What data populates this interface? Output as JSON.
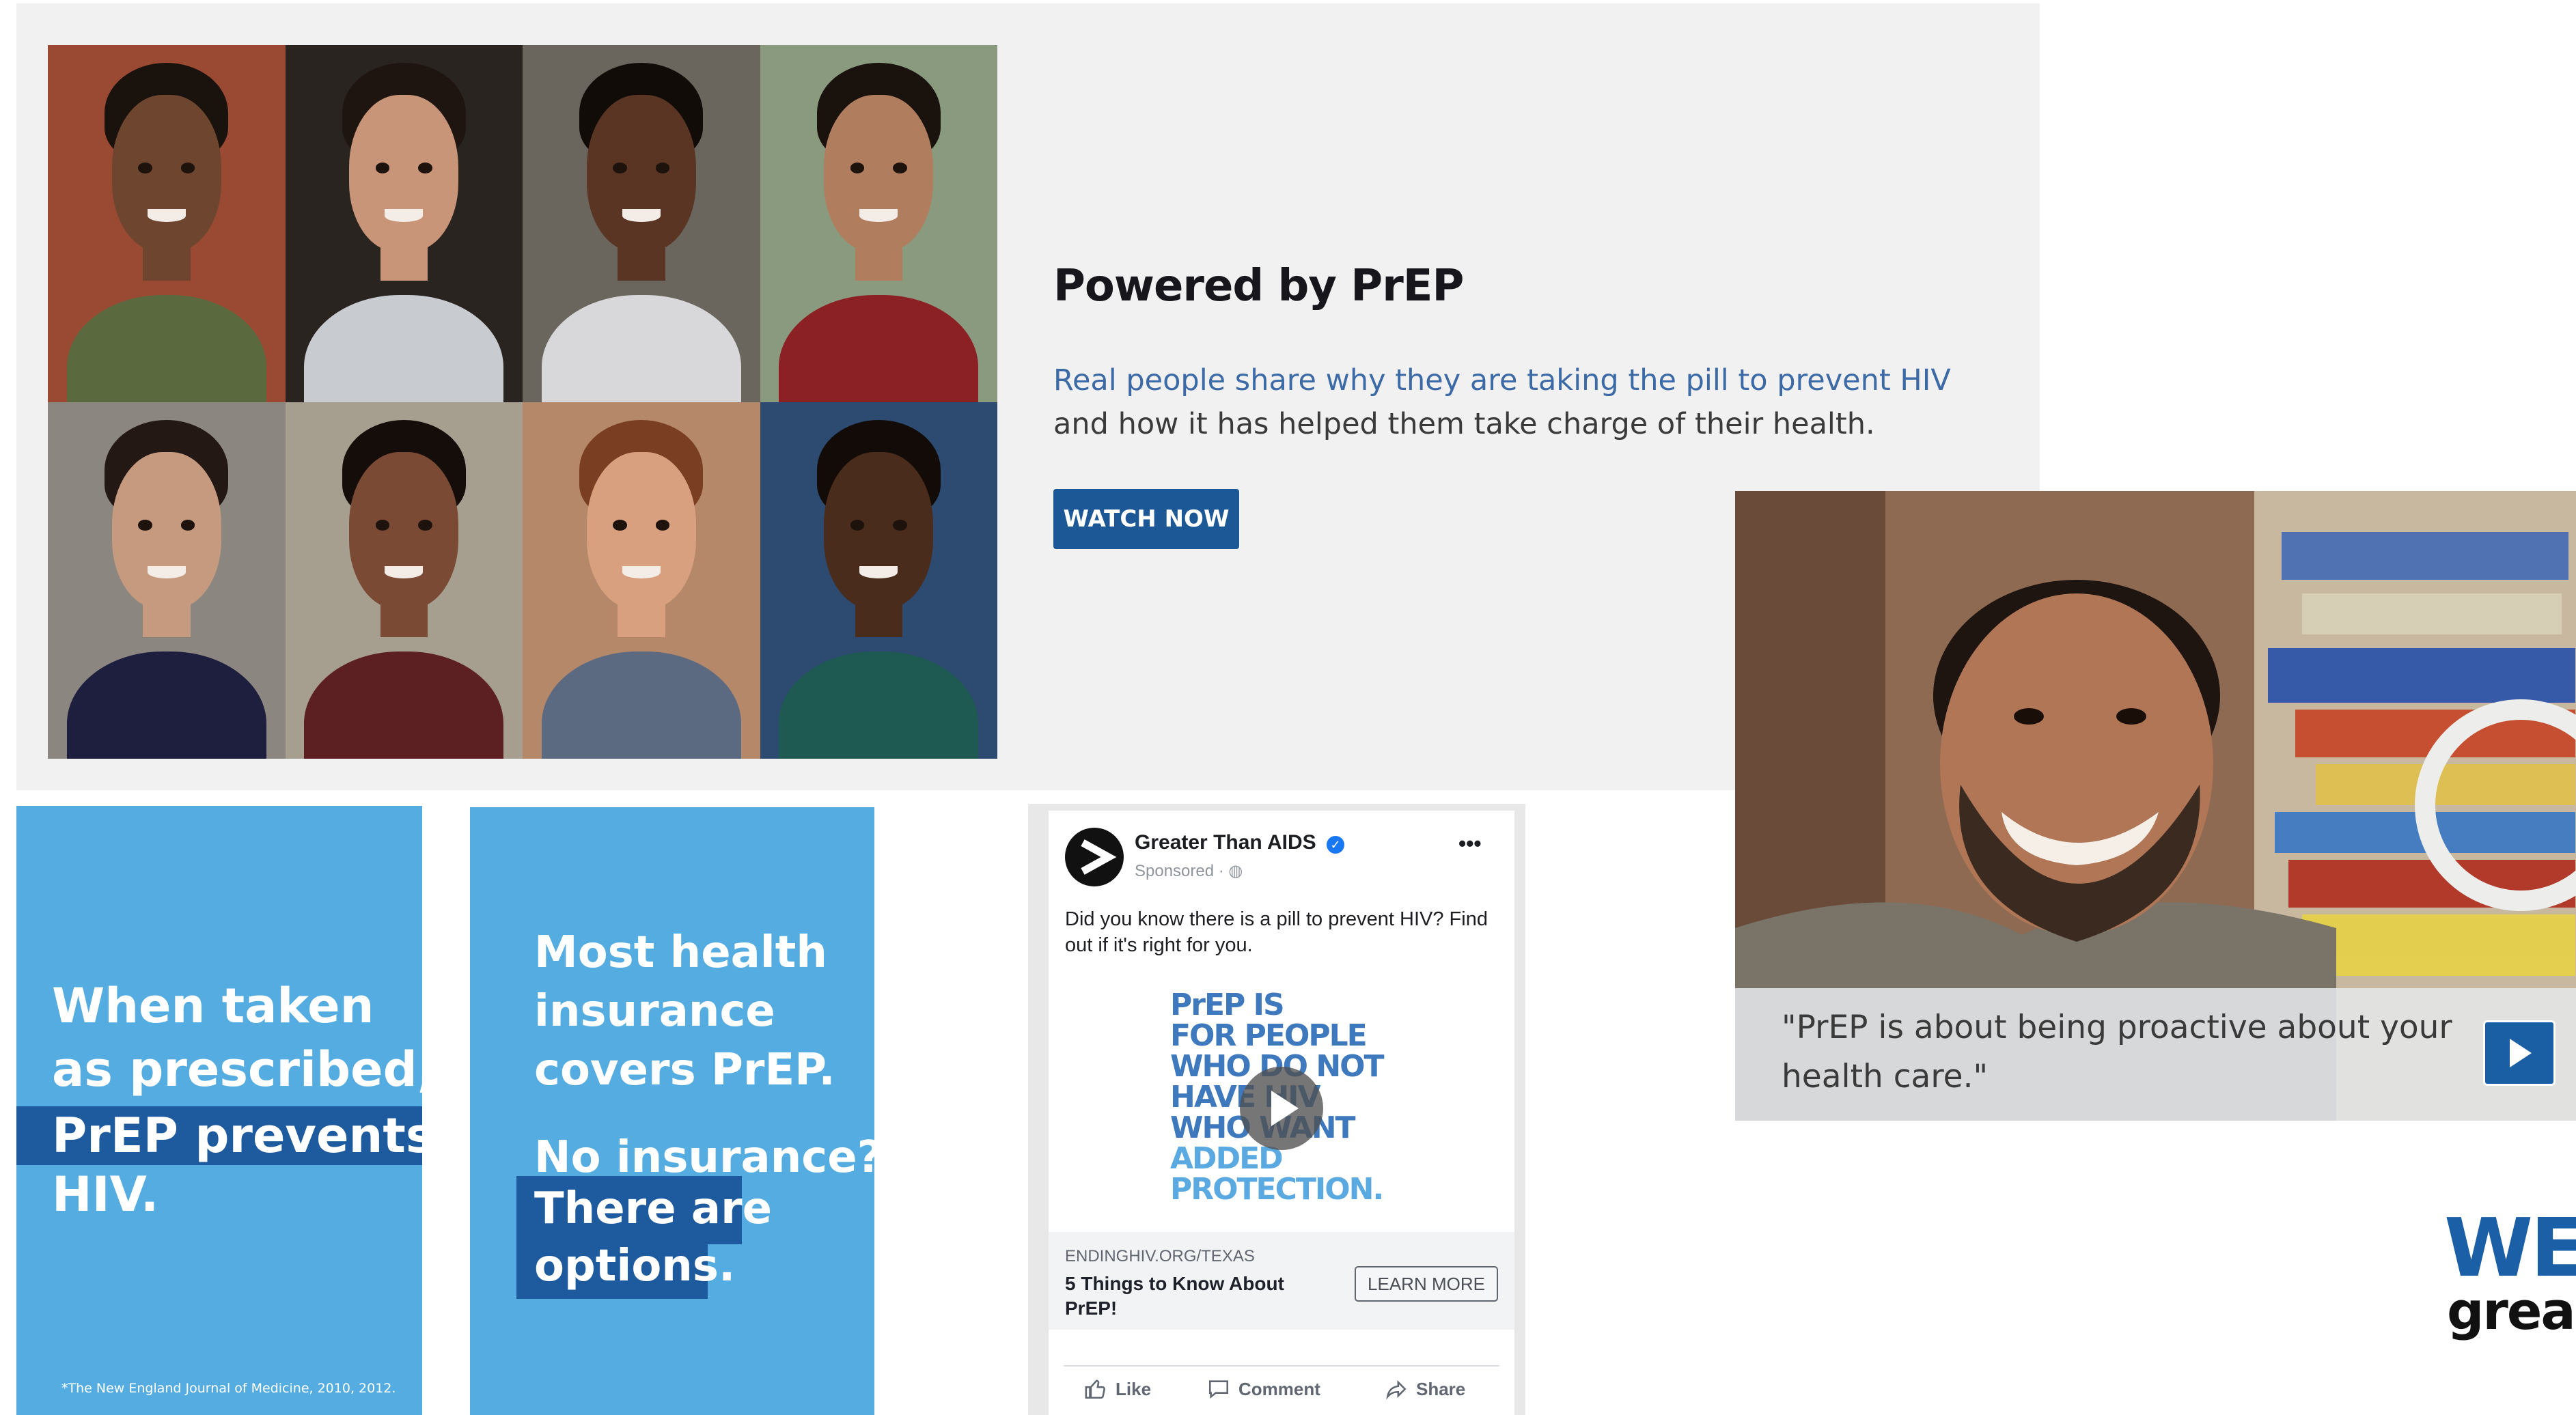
{
  "banner": {
    "title": "Powered by PrEP",
    "description_link": "Real people share why they are taking the pill to prevent HIV",
    "description_rest": " and how it has helped them take charge of their health.",
    "cta": "WATCH NOW",
    "portraits": [
      {
        "bg": "#9a4a32",
        "skin": "#6e4630",
        "hair": "#1a120c",
        "shirt": "#5b6a3e"
      },
      {
        "bg": "#2a2420",
        "skin": "#c89578",
        "hair": "#1e1510",
        "shirt": "#c8cbd0"
      },
      {
        "bg": "#6a665e",
        "skin": "#5a3524",
        "hair": "#120c09",
        "shirt": "#d8d8da"
      },
      {
        "bg": "#8a9a7e",
        "skin": "#b07e5e",
        "hair": "#1a120d",
        "shirt": "#8c2125"
      },
      {
        "bg": "#8b8780",
        "skin": "#c59a7e",
        "hair": "#231813",
        "shirt": "#1e1f3e"
      },
      {
        "bg": "#a69e8e",
        "skin": "#7a4a34",
        "hair": "#140d0a",
        "shirt": "#5c1f22"
      },
      {
        "bg": "#b5886a",
        "skin": "#d8a07e",
        "hair": "#7a3e22",
        "shirt": "#5b6a80"
      },
      {
        "bg": "#2d4a70",
        "skin": "#4a2c1c",
        "hair": "#120b08",
        "shirt": "#1f5a52"
      }
    ]
  },
  "ad1": {
    "line1": "When taken",
    "line2": "as prescribed,",
    "line3": "PrEP prevents",
    "line4": "HIV.",
    "footnote": "*The New England Journal of Medicine, 2010, 2012."
  },
  "ad2": {
    "line1": "Most health",
    "line2": "insurance",
    "line3": "covers PrEP.",
    "line4": "No insurance?",
    "line5": "There are",
    "line6": "options."
  },
  "facebook_ad": {
    "page_name": "Greater Than AIDS",
    "verified_icon": "check",
    "sponsored": "Sponsored · ",
    "globe_icon": "globe-icon",
    "more_icon": "•••",
    "post_text": "Did you know there is a pill to prevent HIV? Find out if it's right for you.",
    "media_lines": [
      {
        "text": "PrEP IS",
        "color": "#3e78bd"
      },
      {
        "text": "FOR PEOPLE",
        "color": "#3e78bd"
      },
      {
        "text": "WHO DO NOT",
        "color": "#3e78bd"
      },
      {
        "text": "HAVE HIV",
        "color": "#3e78bd"
      },
      {
        "text": "WHO WANT",
        "color": "#3e78bd"
      },
      {
        "text": "ADDED",
        "color": "#5aa9e0"
      },
      {
        "text": "PROTECTION.",
        "color": "#5aa9e0"
      }
    ],
    "link_domain": "ENDINGHIV.ORG/TEXAS",
    "link_headline": "5 Things to Know About PrEP!",
    "cta": "LEARN MORE",
    "actions": {
      "like": "Like",
      "comment": "Comment",
      "share": "Share"
    }
  },
  "video": {
    "caption": "\"PrEP is about being proactive about your health care.\""
  },
  "logo": {
    "we": "WE",
    "great": "grea"
  }
}
